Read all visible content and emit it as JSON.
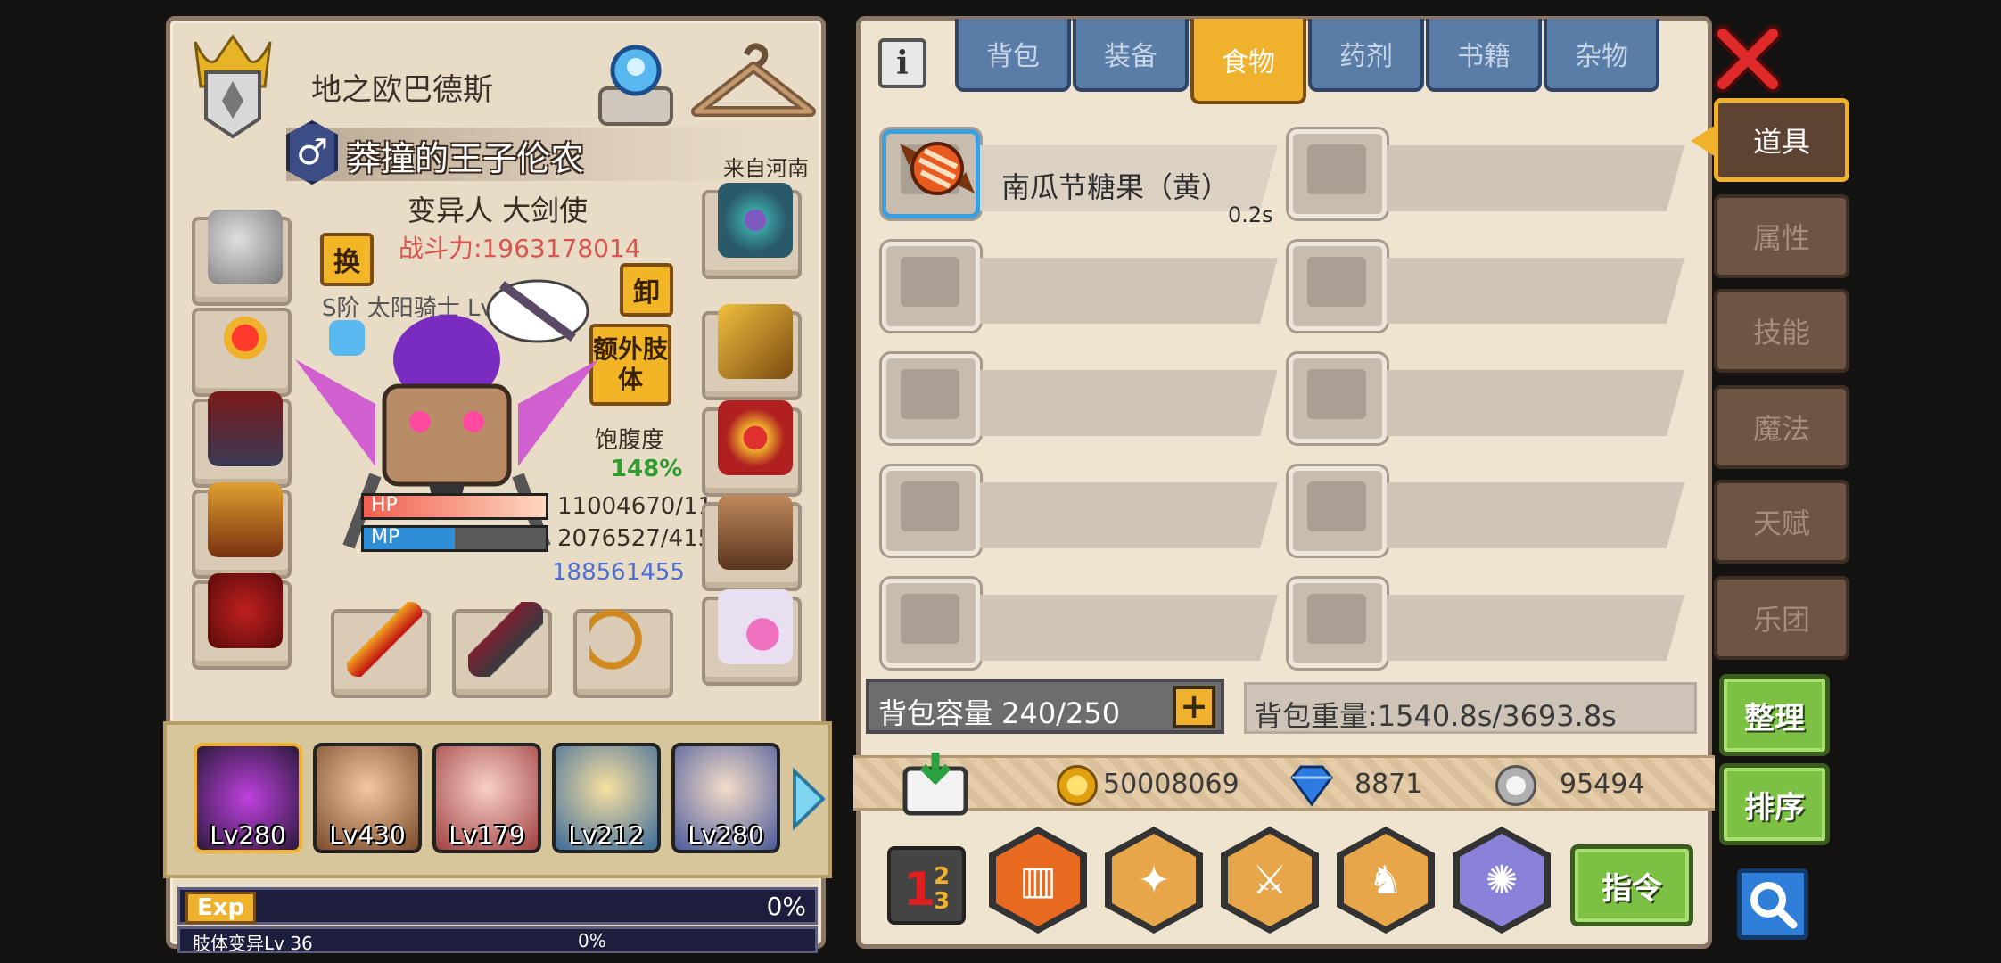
{
  "character": {
    "title": "地之欧巴德斯",
    "gender_symbol": "♂",
    "name": "莽撞的王子伦农",
    "origin": "来自河南",
    "class": "变异人 大剑使",
    "combat_power": "战斗力:1963178014",
    "pet_line": "S阶 太阳骑士 Lv 100",
    "swap_button": "换",
    "unequip_button": "卸",
    "extra_limb_button": "额外肢体",
    "satiety_label": "饱腹度",
    "satiety_value": "148%",
    "hp_label": "HP",
    "hp_value": "11004670/11",
    "mp_label": "MP",
    "mp_value": "2076527/415",
    "extra_value": "188561455",
    "hp_fill": 1.0,
    "mp_fill": 0.5
  },
  "party": [
    {
      "level": "Lv280"
    },
    {
      "level": "Lv430"
    },
    {
      "level": "Lv179"
    },
    {
      "level": "Lv212"
    },
    {
      "level": "Lv280"
    }
  ],
  "exp": {
    "label": "Exp",
    "percent": "0%",
    "limb_label": "肢体变异Lv 36",
    "limb_percent": "0%"
  },
  "inventory": {
    "tabs": [
      "背包",
      "装备",
      "食物",
      "药剂",
      "书籍",
      "杂物"
    ],
    "active_tab": "食物",
    "items": [
      {
        "name": "南瓜节糖果（黄）",
        "weight": "0.2s"
      }
    ],
    "capacity": "背包容量 240/250",
    "weight": "背包重量:1540.8s/3693.8s"
  },
  "currency": {
    "gold": "50008069",
    "diamond": "8871",
    "silver": "95494"
  },
  "buttons": {
    "command": "指令",
    "organize": "整理",
    "sort": "排序"
  },
  "side_tabs": [
    "道具",
    "属性",
    "技能",
    "魔法",
    "天赋",
    "乐团"
  ],
  "colors": {
    "active_tab": "#f0b12c",
    "inactive_tab": "#5a7da8",
    "green_button": "#7cc044",
    "combat_power": "#d9534f",
    "satiety": "#2e9b2e",
    "extra_value": "#4d6fd1"
  }
}
